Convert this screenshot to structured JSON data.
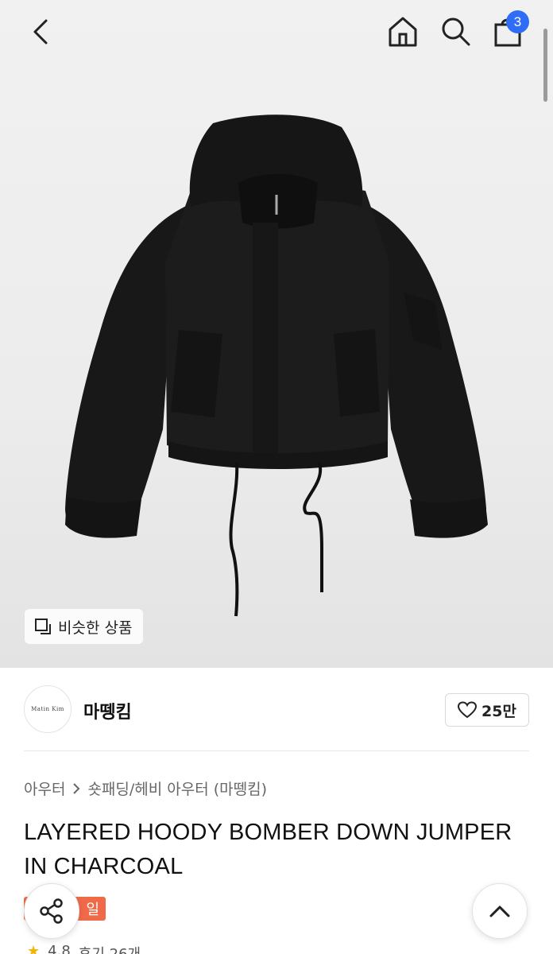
{
  "header": {
    "back_icon": "chevron-left-icon",
    "home_icon": "home-icon",
    "search_icon": "search-icon",
    "bag_icon": "shopping-bag-icon",
    "bag_badge": "3",
    "badge_color": "#2f6df6"
  },
  "hero": {
    "similar_label": "비슷한 상품",
    "similar_icon": "similar-products-icon"
  },
  "brand": {
    "logo_text": "Matin  Kim",
    "name": "마뗑킴",
    "like_count": "25만",
    "like_icon": "heart-icon"
  },
  "breadcrumb": {
    "category": "아우터",
    "separator_icon": "chevron-right-icon",
    "subcategory": "숏패딩/헤비 아우터 (마뗑킴)"
  },
  "product": {
    "title": "LAYERED HOODY BOMBER DOWN JUMPER IN CHARCOAL",
    "sale_tag": "일",
    "sale_color": "#f06a4a",
    "rating": "4.8",
    "reviews": "후기 26개"
  },
  "floating": {
    "share_icon": "share-icon",
    "top_icon": "chevron-up-icon"
  }
}
